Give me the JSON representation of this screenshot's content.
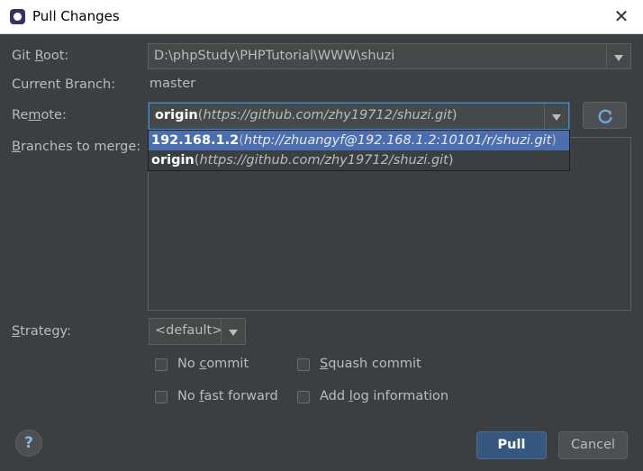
{
  "window": {
    "title": "Pull Changes",
    "close_glyph": "✕"
  },
  "labels": {
    "git_root_pre": "Git ",
    "git_root_u": "R",
    "git_root_post": "oot:",
    "current_branch": "Current Branch:",
    "remote_pre": "Re",
    "remote_u": "m",
    "remote_post": "ote:",
    "branches_u": "B",
    "branches_post": "ranches to merge:",
    "strategy_u": "S",
    "strategy_post": "trategy:"
  },
  "git_root": {
    "value": "D:\\phpStudy\\PHPTutorial\\WWW\\shuzi"
  },
  "current_branch": {
    "value": "master"
  },
  "remote": {
    "selected_name": "origin",
    "selected_url": "https://github.com/zhy19712/shuzi.git",
    "options": [
      {
        "name": "192.168.1.2",
        "url": "http://zhuangyf@192.168.1.2:10101/r/shuzi.git",
        "highlighted": true
      },
      {
        "name": "origin",
        "url": "https://github.com/zhy19712/shuzi.git",
        "highlighted": false
      }
    ]
  },
  "strategy": {
    "value": "<default>"
  },
  "checkboxes": {
    "no_commit": {
      "pre": "No ",
      "u": "c",
      "post": "ommit",
      "checked": false
    },
    "squash_commit": {
      "pre": "",
      "u": "S",
      "post": "quash commit",
      "checked": false
    },
    "no_fast_forward": {
      "pre": "No ",
      "u": "f",
      "post": "ast forward",
      "checked": false
    },
    "add_log": {
      "pre": "Add ",
      "u": "l",
      "post": "og information",
      "checked": false
    }
  },
  "buttons": {
    "help": "?",
    "pull": "Pull",
    "cancel": "Cancel"
  },
  "icons": {
    "app": "phpstorm-icon",
    "refresh": "refresh-icon",
    "close": "close-icon"
  },
  "colors": {
    "background": "#3c3f41",
    "selection": "#4b6eaf",
    "default_button": "#365880"
  }
}
